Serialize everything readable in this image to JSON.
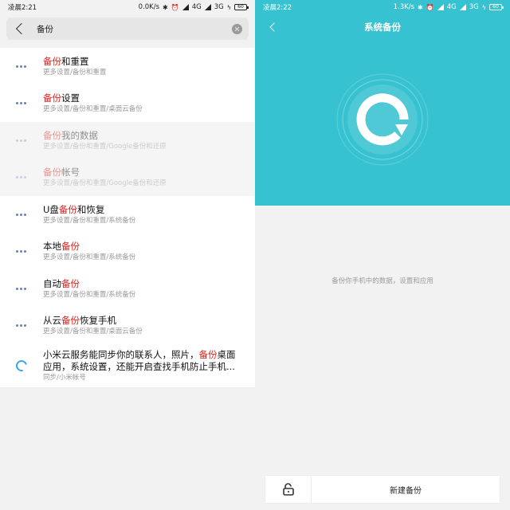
{
  "left": {
    "status": {
      "time": "凌晨2:21",
      "speed": "0.0K/s",
      "net1": "4G",
      "net2": "3G",
      "battery": "60"
    },
    "search": {
      "query": "备份"
    },
    "results": [
      {
        "title_pre": "",
        "title_hl": "备份",
        "title_post": "和重置",
        "sub": "更多设置/备份和重置",
        "dim": false
      },
      {
        "title_pre": "",
        "title_hl": "备份",
        "title_post": "设置",
        "sub": "更多设置/备份和重置/桌面云备份",
        "dim": false
      },
      {
        "title_pre": "",
        "title_hl": "备份",
        "title_post": "我的数据",
        "sub": "更多设置/备份和重置/Google备份和还原",
        "dim": true
      },
      {
        "title_pre": "",
        "title_hl": "备份",
        "title_post": "帐号",
        "sub": "更多设置/备份和重置/Google备份和还原",
        "dim": true
      },
      {
        "title_pre": "U盘",
        "title_hl": "备份",
        "title_post": "和恢复",
        "sub": "更多设置/备份和重置/系统备份",
        "dim": false
      },
      {
        "title_pre": "本地",
        "title_hl": "备份",
        "title_post": "",
        "sub": "更多设置/备份和重置/系统备份",
        "dim": false
      },
      {
        "title_pre": "自动",
        "title_hl": "备份",
        "title_post": "",
        "sub": "更多设置/备份和重置/系统备份",
        "dim": false
      },
      {
        "title_pre": "从云",
        "title_hl": "备份",
        "title_post": "恢复手机",
        "sub": "更多设置/备份和重置/桌面云备份",
        "dim": false
      }
    ],
    "cloud_item": {
      "line1_pre": "小米云服务能同步你的联系人，照片，",
      "line1_hl": "备份",
      "line1_post": "桌面",
      "line2": "应用，系统设置，还能开启查找手机防止手机...",
      "sub": "同步/小米帐号"
    }
  },
  "right": {
    "status": {
      "time": "凌晨2:22",
      "speed": "1.3K/s",
      "net1": "4G",
      "net2": "3G",
      "battery": "60"
    },
    "title": "系统备份",
    "info": "备份你手机中的数据，设置和应用",
    "new_backup_label": "新建备份"
  },
  "colors": {
    "accent": "#36c2d0",
    "highlight": "#e0231c"
  }
}
